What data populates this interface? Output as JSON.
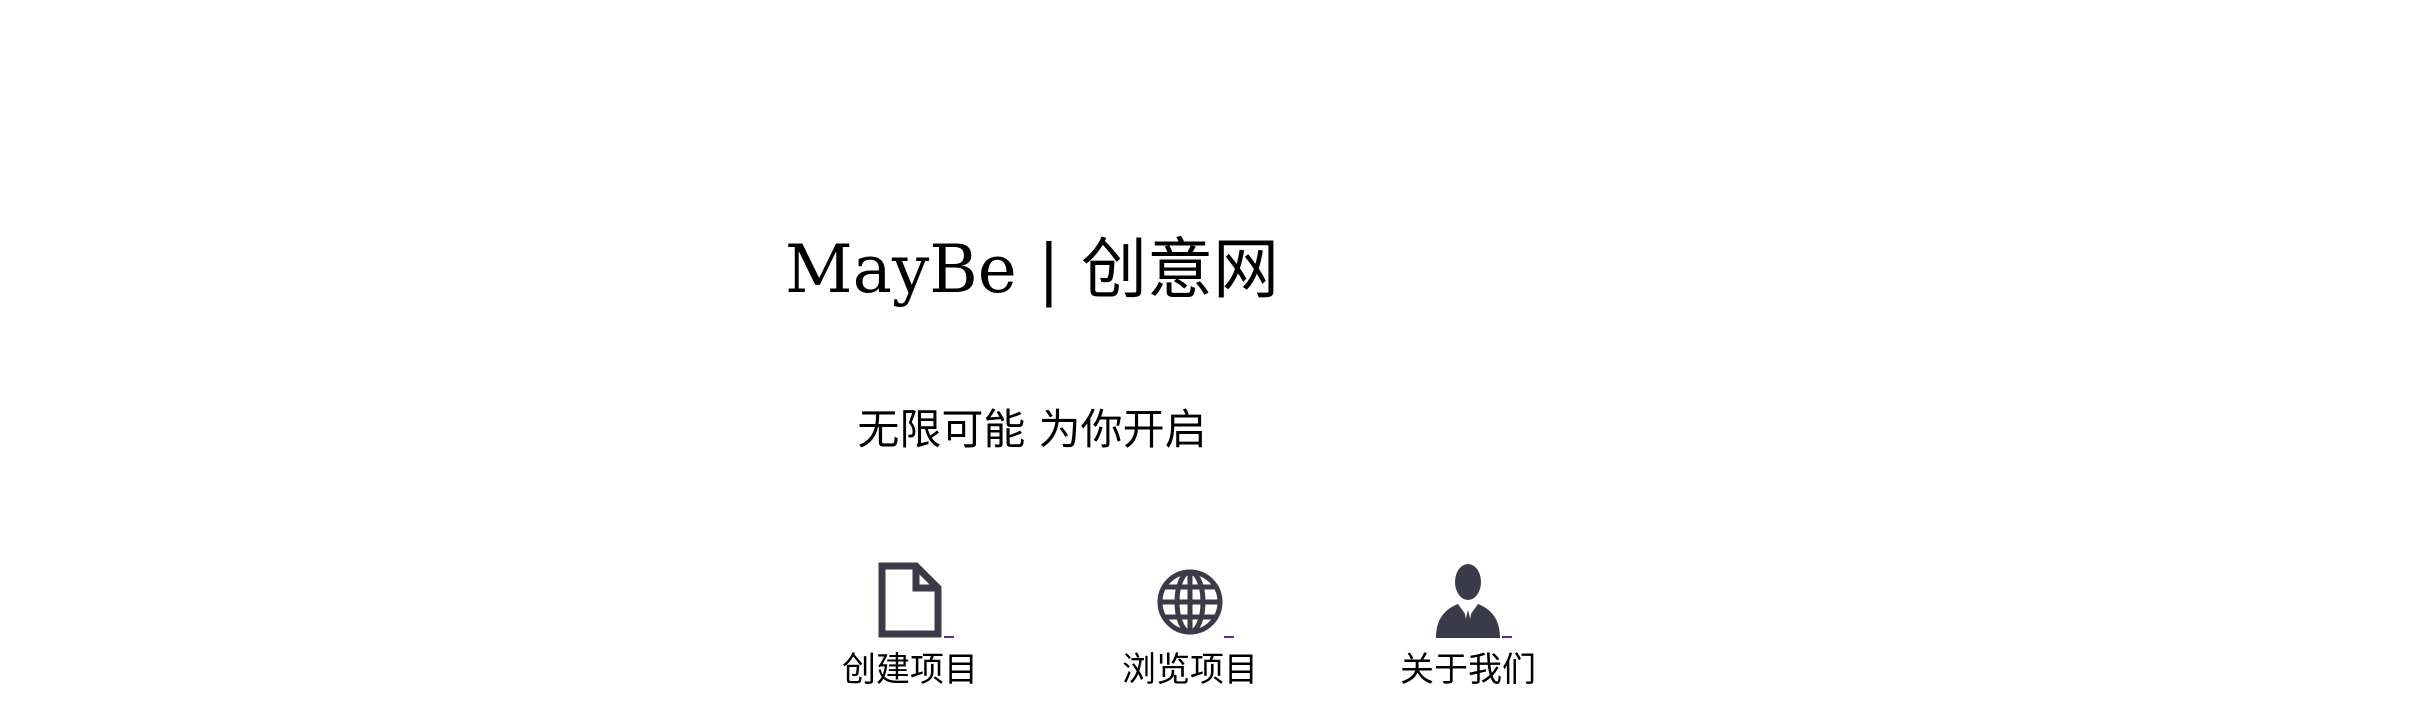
{
  "header": {
    "title": "MayBe | 创意网",
    "tagline": "无限可能 为你开启"
  },
  "nav": [
    {
      "label": "创建项目",
      "icon": "document-icon"
    },
    {
      "label": "浏览项目",
      "icon": "globe-icon"
    },
    {
      "label": "关于我们",
      "icon": "person-icon"
    }
  ],
  "colors": {
    "background": "#ffffff",
    "text": "#000000",
    "icon": "#3a3a48",
    "link_underline": "#5b2d9a"
  }
}
